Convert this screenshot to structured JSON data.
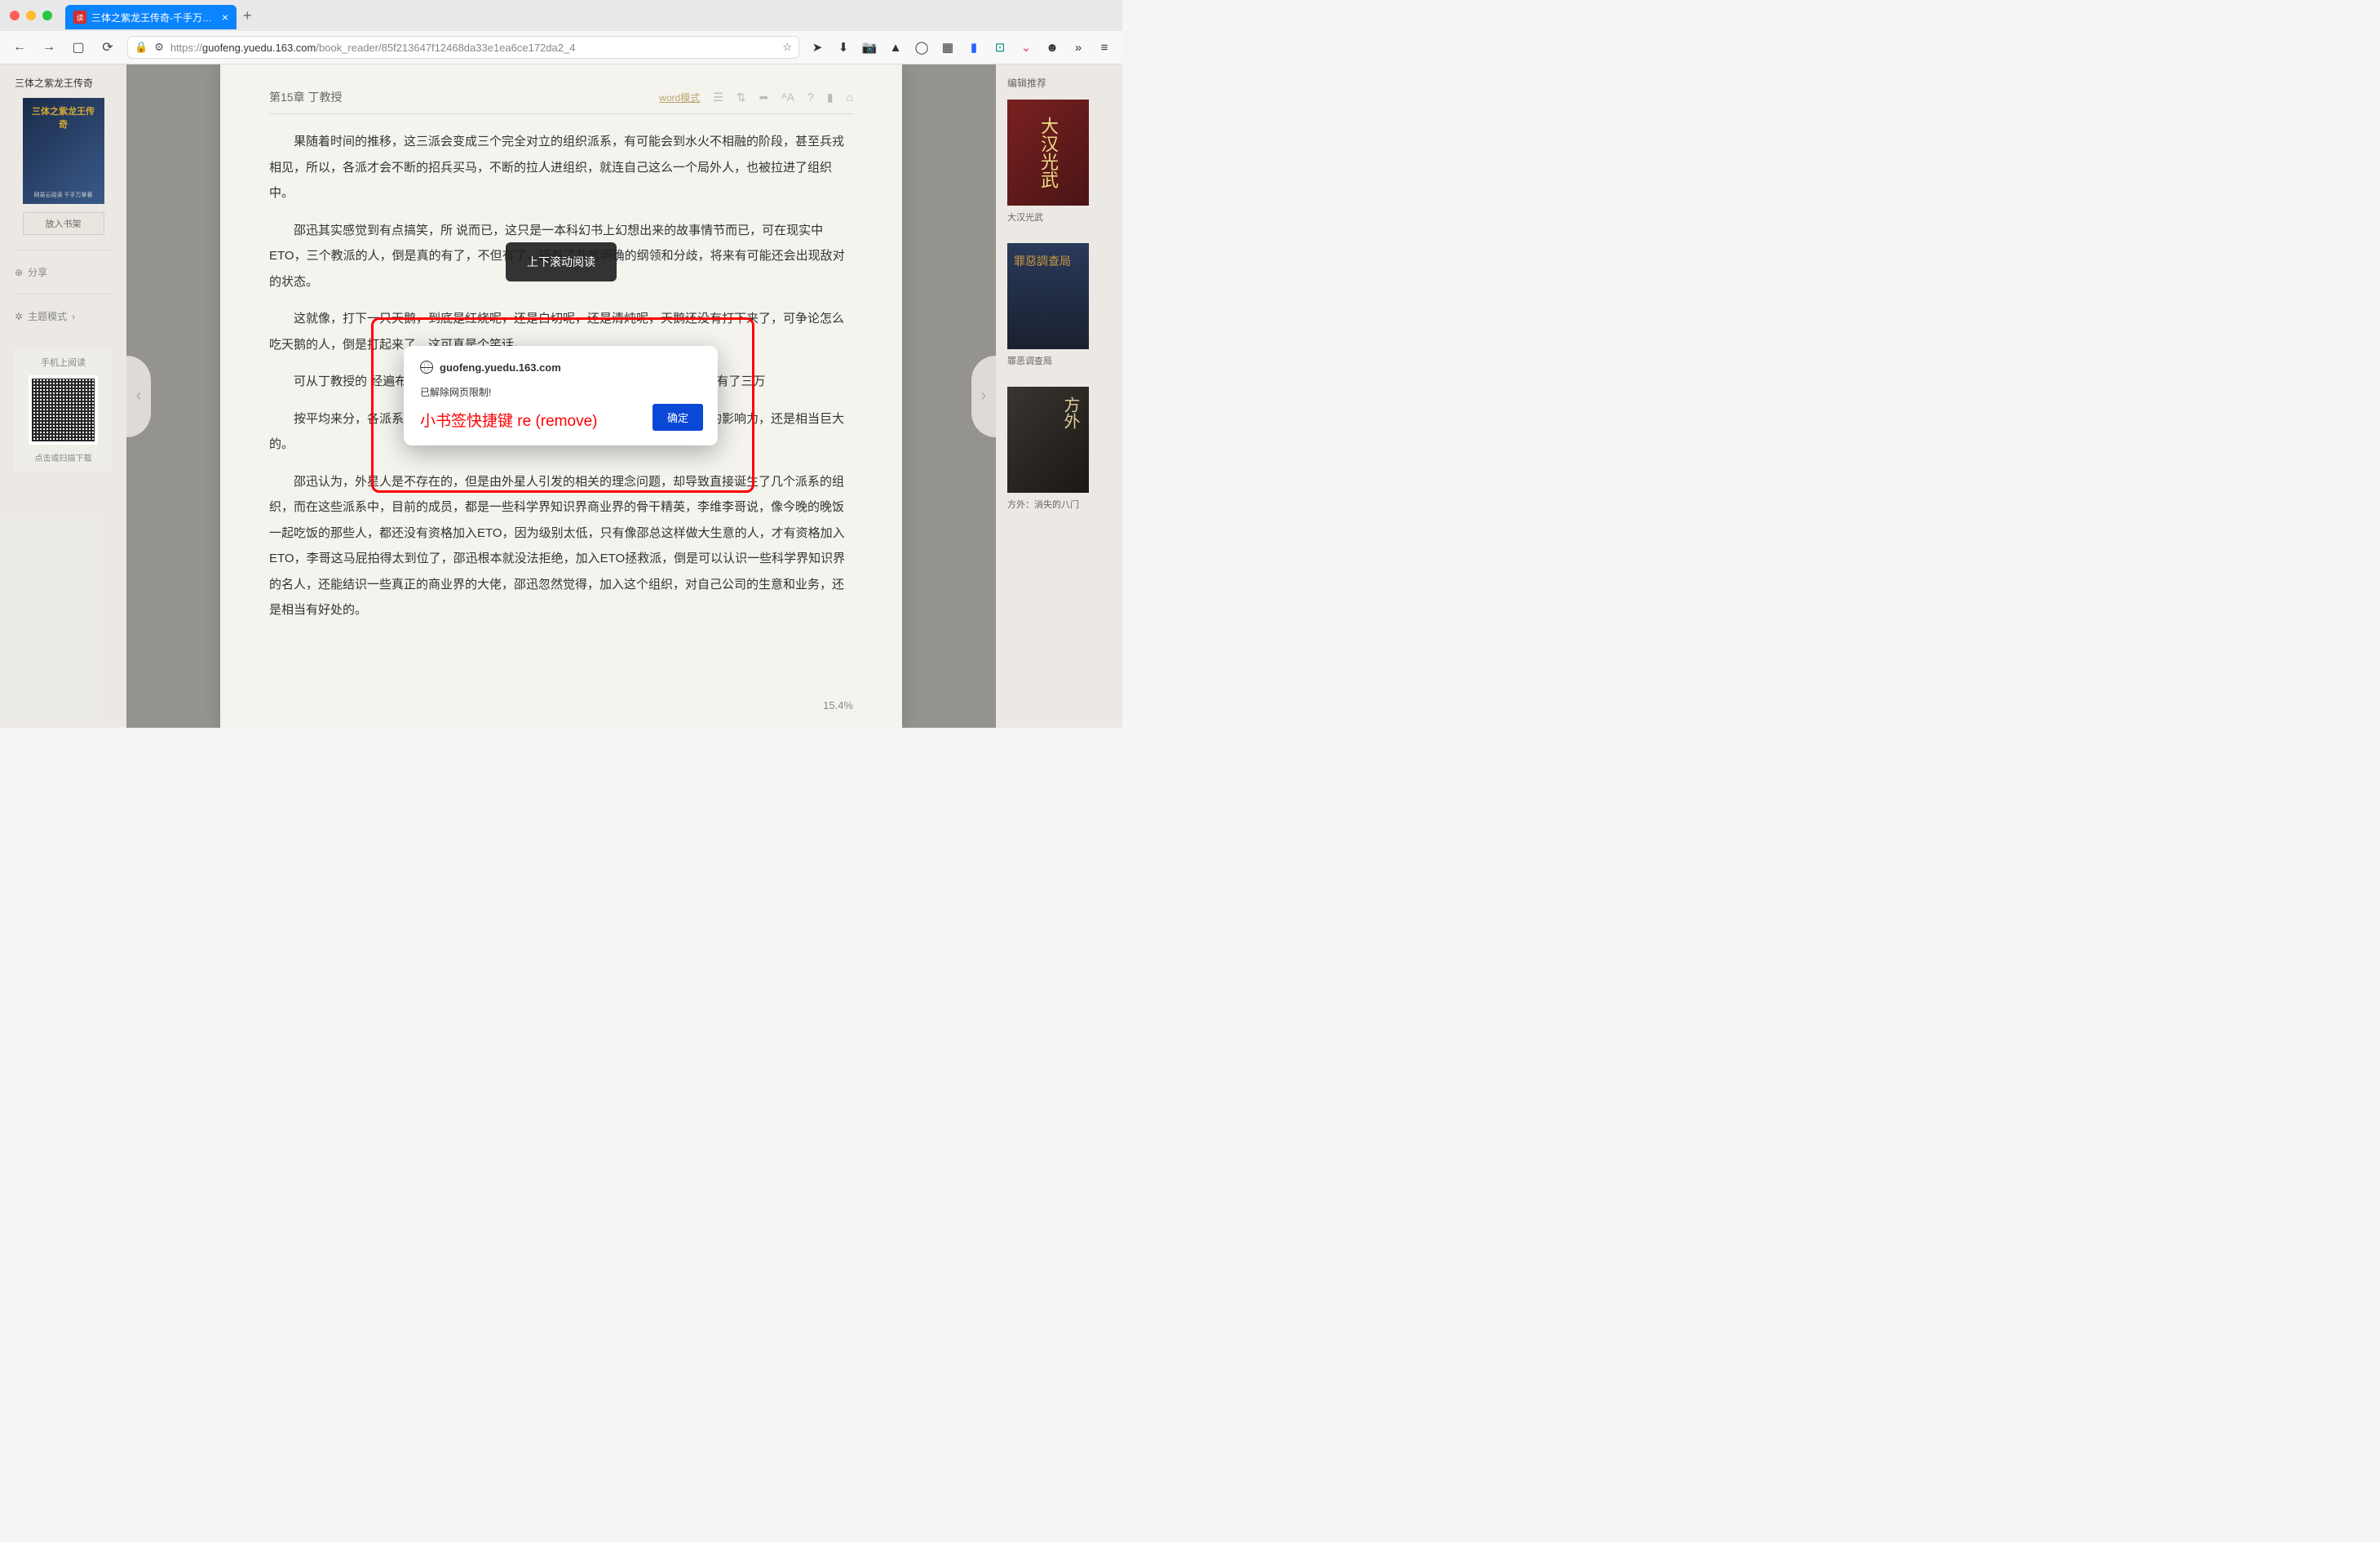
{
  "browser": {
    "tab": {
      "title": "三体之紫龙王传奇-千手万掌-免费阅",
      "favicon": "读"
    },
    "url": {
      "proto": "https://",
      "domain": "guofeng.yuedu.163.com",
      "path": "/book_reader/85f213647f12468da33e1ea6ce172da2_4"
    }
  },
  "leftSidebar": {
    "bookTitle": "三体之紫龙王传奇",
    "coverText": "三体之紫龙王传奇",
    "coverBottom": "网易云阅读  千手万掌著",
    "addShelf": "放入书架",
    "share": "分享",
    "theme": "主题模式",
    "mobileRead": "手机上阅读",
    "download": "点击或扫描下载"
  },
  "reader": {
    "chapterTitle": "第15章 丁教授",
    "wordMode": "word模式",
    "paragraphs": [
      "果随着时间的推移，这三派会变成三个完全对立的组织派系，有可能会到水火不相融的阶段，甚至兵戎相见，所以，各派才会不断的招兵买马，不断的拉人进组织，就连自己这么一个局外人，也被拉进了组织中。",
      "邵迅其实感觉到有点搞笑，所                              说而已，这只是一本科幻书上幻想出来的故事情节而已，可在现实中                              ETO，三个教派的人，倒是真的有了，不但有了，还有了非常明确的纲领和分歧，将来有可能还会出现敌对的状态。",
      "这就像，打下一只天鹅，到底是红烧呢，还是白切呢，还是清炖呢，天鹅还没有打下来了，可争论怎么吃天鹅的人，倒是打起来了，这可真是个笑话。",
      "可从丁教授的                                                                          经遍布全球多个国家，多个领域，成                                                                          万了，光上海这地方，已经有了三万",
      "按平均来分，各派系也有一万多人了，这个规模已经很大了，这说明这个组织的影响力，还是相当巨大的。",
      "邵迅认为，外星人是不存在的，但是由外星人引发的相关的理念问题，却导致直接诞生了几个派系的组织，而在这些派系中，目前的成员，都是一些科学界知识界商业界的骨干精英，李维李哥说，像今晚的晚饭一起吃饭的那些人，都还没有资格加入ETO，因为级别太低，只有像邵总这样做大生意的人，才有资格加入ETO，李哥这马屁拍得太到位了，邵迅根本就没法拒绝，加入ETO拯救派，倒是可以认识一些科学界知识界的名人，还能结识一些真正的商业界的大佬，邵迅忽然觉得，加入这个组织，对自己公司的生意和业务，还是相当有好处的。"
    ],
    "progress": "15.4%",
    "scrollTip": "上下滚动阅读"
  },
  "rightSidebar": {
    "title": "编辑推荐",
    "items": [
      {
        "cover": "大汉光武",
        "label": "大汉光武"
      },
      {
        "cover": "罪惡調查局",
        "label": "罪恶调查局"
      },
      {
        "cover": "方外",
        "label": "方外：消失的八门"
      }
    ]
  },
  "alert": {
    "origin": "guofeng.yuedu.163.com",
    "msg1": "已解除网页限制!",
    "msg2": "小书签快捷键 re (remove)",
    "ok": "确定"
  }
}
